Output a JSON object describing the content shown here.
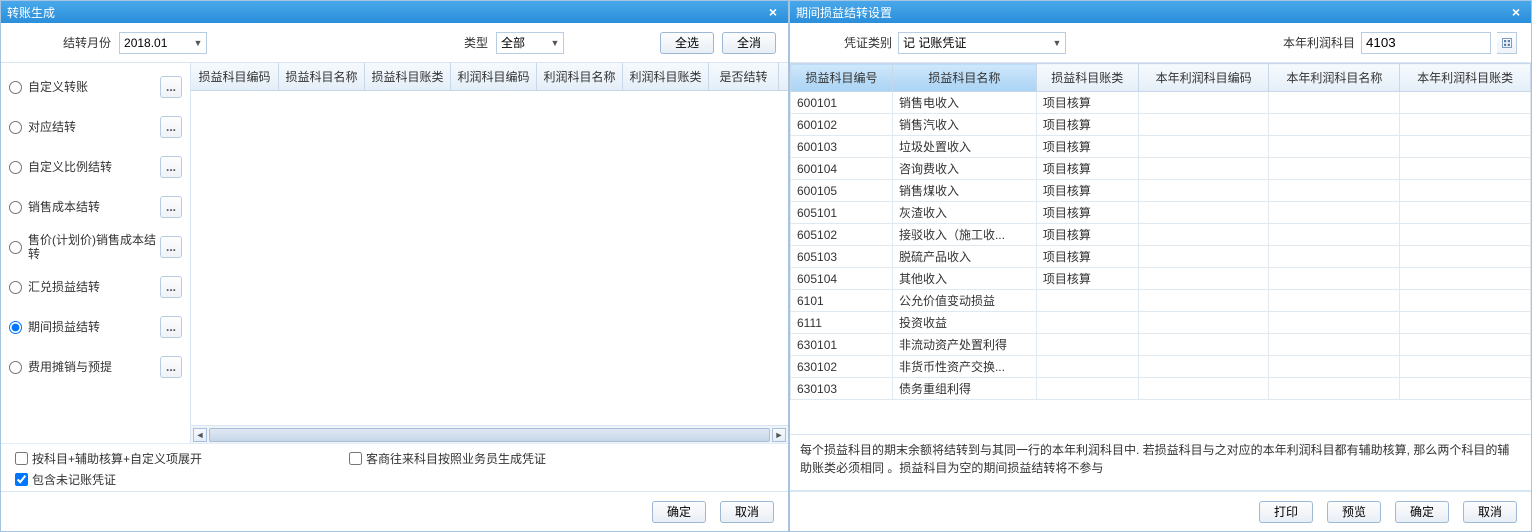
{
  "left": {
    "title": "转账生成",
    "toolbar": {
      "month_label": "结转月份",
      "month_value": "2018.01",
      "type_label": "类型",
      "type_value": "全部",
      "select_all": "全选",
      "select_none": "全消"
    },
    "options": [
      {
        "label": "自定义转账",
        "checked": false
      },
      {
        "label": "对应结转",
        "checked": false
      },
      {
        "label": "自定义比例结转",
        "checked": false
      },
      {
        "label": "销售成本结转",
        "checked": false
      },
      {
        "label": "售价(计划价)销售成本结转",
        "checked": false
      },
      {
        "label": "汇兑损益结转",
        "checked": false
      },
      {
        "label": "期间损益结转",
        "checked": true
      },
      {
        "label": "费用摊销与预提",
        "checked": false
      }
    ],
    "grid_headers": [
      "损益科目编码",
      "损益科目名称",
      "损益科目账类",
      "利润科目编码",
      "利润科目名称",
      "利润科目账类",
      "是否结转"
    ],
    "checks": {
      "expand": "按科目+辅助核算+自定义项展开",
      "include": "包含未记账凭证",
      "cust": "客商往来科目按照业务员生成凭证"
    },
    "footer": {
      "ok": "确定",
      "cancel": "取消"
    }
  },
  "right": {
    "title": "期间损益结转设置",
    "toolbar": {
      "voucher_label": "凭证类别",
      "voucher_value": "记 记账凭证",
      "profit_label": "本年利润科目",
      "profit_value": "4103"
    },
    "headers": [
      "损益科目编号",
      "损益科目名称",
      "损益科目账类",
      "本年利润科目编码",
      "本年利润科目名称",
      "本年利润科目账类"
    ],
    "rows": [
      {
        "c0": "600101",
        "c1": "销售电收入",
        "c2": "项目核算",
        "c3": "",
        "c4": "",
        "c5": ""
      },
      {
        "c0": "600102",
        "c1": "销售汽收入",
        "c2": "项目核算",
        "c3": "",
        "c4": "",
        "c5": ""
      },
      {
        "c0": "600103",
        "c1": "垃圾处置收入",
        "c2": "项目核算",
        "c3": "",
        "c4": "",
        "c5": ""
      },
      {
        "c0": "600104",
        "c1": "咨询费收入",
        "c2": "项目核算",
        "c3": "",
        "c4": "",
        "c5": ""
      },
      {
        "c0": "600105",
        "c1": "销售煤收入",
        "c2": "项目核算",
        "c3": "",
        "c4": "",
        "c5": ""
      },
      {
        "c0": "605101",
        "c1": "灰渣收入",
        "c2": "项目核算",
        "c3": "",
        "c4": "",
        "c5": ""
      },
      {
        "c0": "605102",
        "c1": "接驳收入（施工收...",
        "c2": "项目核算",
        "c3": "",
        "c4": "",
        "c5": ""
      },
      {
        "c0": "605103",
        "c1": "脱硫产品收入",
        "c2": "项目核算",
        "c3": "",
        "c4": "",
        "c5": ""
      },
      {
        "c0": "605104",
        "c1": "其他收入",
        "c2": "项目核算",
        "c3": "",
        "c4": "",
        "c5": ""
      },
      {
        "c0": "6101",
        "c1": "公允价值变动损益",
        "c2": "",
        "c3": "",
        "c4": "",
        "c5": ""
      },
      {
        "c0": "6111",
        "c1": "投资收益",
        "c2": "",
        "c3": "",
        "c4": "",
        "c5": ""
      },
      {
        "c0": "630101",
        "c1": "非流动资产处置利得",
        "c2": "",
        "c3": "",
        "c4": "",
        "c5": ""
      },
      {
        "c0": "630102",
        "c1": "非货币性资产交换...",
        "c2": "",
        "c3": "",
        "c4": "",
        "c5": ""
      },
      {
        "c0": "630103",
        "c1": "债务重组利得",
        "c2": "",
        "c3": "",
        "c4": "",
        "c5": ""
      }
    ],
    "note": "每个损益科目的期末余额将结转到与其同一行的本年利润科目中. 若损益科目与之对应的本年利润科目都有辅助核算, 那么两个科目的辅助账类必须相同 。损益科目为空的期间损益结转将不参与",
    "footer": {
      "print": "打印",
      "preview": "预览",
      "ok": "确定",
      "cancel": "取消"
    }
  }
}
